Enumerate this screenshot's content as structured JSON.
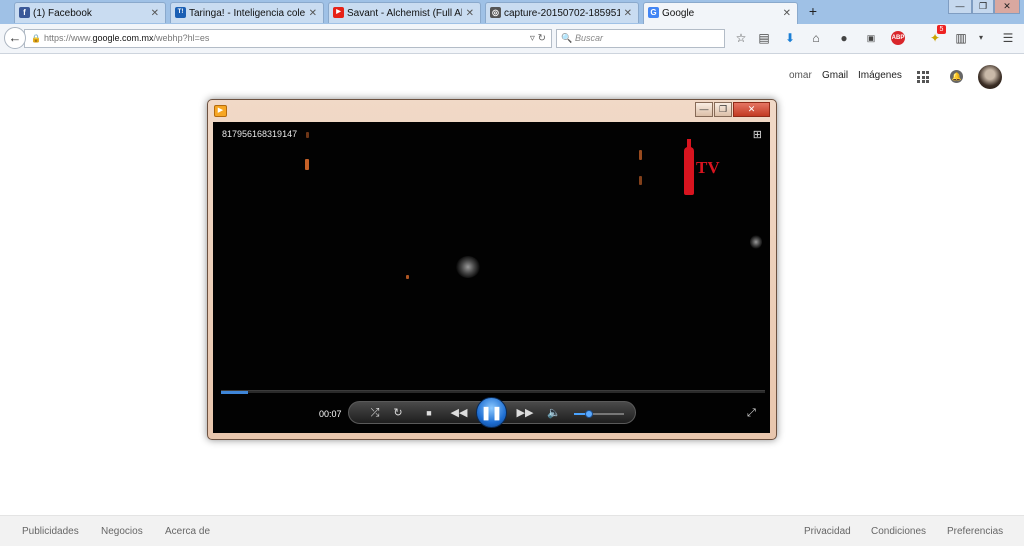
{
  "browser": {
    "tabs": [
      {
        "label": "(1) Facebook",
        "favicon": "facebook-icon",
        "color": "#3b5998",
        "glyph": "f",
        "close": "✕"
      },
      {
        "label": "Taringa! - Inteligencia cole...",
        "favicon": "taringa-icon",
        "color": "#1a5fb4",
        "glyph": "T!",
        "close": "✕"
      },
      {
        "label": "Savant - Alchemist (Full Al...",
        "favicon": "youtube-icon",
        "color": "#e62117",
        "glyph": "▶",
        "close": "✕"
      },
      {
        "label": "capture-20150702-185951_...",
        "favicon": "camera-icon",
        "color": "#555555",
        "glyph": "◎",
        "close": "✕"
      },
      {
        "label": "Google",
        "favicon": "google-icon",
        "color": "#4285f4",
        "glyph": "G",
        "close": "✕"
      }
    ],
    "new_tab": "+",
    "window_controls": {
      "minimize": "—",
      "maximize": "❐",
      "close": "✕"
    },
    "url_scheme": "https://www.",
    "url_host": "google.com.mx",
    "url_path": "/webhp?hl=es",
    "search_placeholder": "Buscar",
    "notification_count": "5",
    "abp_label": "ABP"
  },
  "google": {
    "user": "omar",
    "gmail": "Gmail",
    "images": "Imágenes"
  },
  "player": {
    "video_id": "817956168319147",
    "overlay_text": "TV",
    "time": "00:07",
    "seek_progress": 0.05,
    "volume_level": 0.3,
    "colors": {
      "accent": "#3f86d8",
      "brand_red": "#d8141f"
    }
  },
  "footer": {
    "left": [
      "Publicidades",
      "Negocios",
      "Acerca de"
    ],
    "right": [
      "Privacidad",
      "Condiciones",
      "Preferencias"
    ]
  }
}
